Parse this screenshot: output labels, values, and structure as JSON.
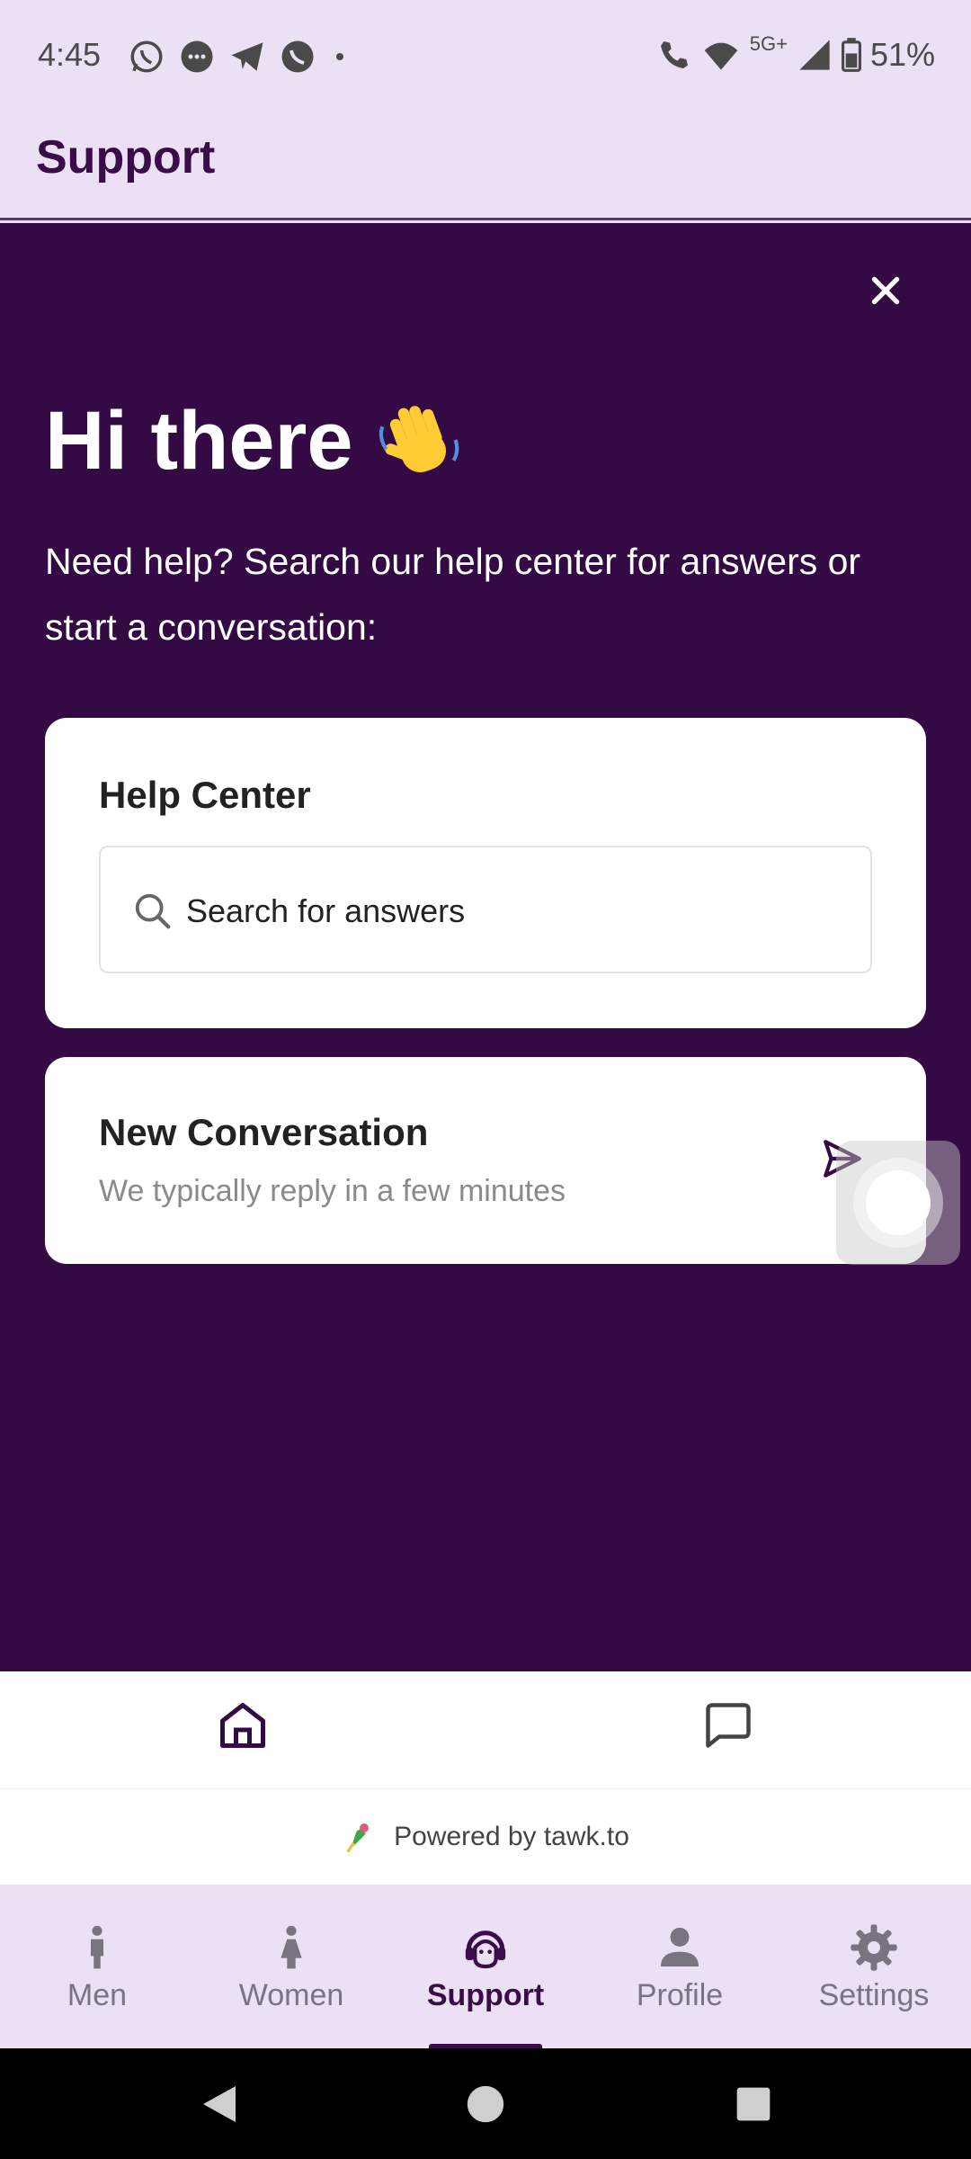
{
  "status_bar": {
    "time": "4:45",
    "network": "5G+",
    "battery": "51%",
    "left_icons": [
      "whatsapp-icon",
      "messages-icon",
      "telegram-icon",
      "viber-icon",
      "dot-icon"
    ],
    "right_icons": [
      "wifi-calling-icon",
      "wifi-icon",
      "signal-icon",
      "battery-icon"
    ]
  },
  "app_bar": {
    "title": "Support"
  },
  "widget": {
    "greeting": "Hi there",
    "greeting_emoji": "waving-hand",
    "intro": "Need help? Search our help center for answers or start a conversation:",
    "help_center": {
      "title": "Help Center",
      "search_placeholder": "Search for answers"
    },
    "new_conversation": {
      "title": "New Conversation",
      "subtitle": "We typically reply in a few minutes"
    },
    "nav_icons": [
      "home-icon",
      "chat-icon"
    ],
    "powered_by": "Powered by tawk.to",
    "colors": {
      "background": "#330a44",
      "card": "#ffffff"
    }
  },
  "bottom_nav": {
    "items": [
      {
        "label": "Men",
        "icon": "man-icon",
        "active": false
      },
      {
        "label": "Women",
        "icon": "woman-icon",
        "active": false
      },
      {
        "label": "Support",
        "icon": "support-agent-icon",
        "active": true
      },
      {
        "label": "Profile",
        "icon": "person-icon",
        "active": false
      },
      {
        "label": "Settings",
        "icon": "gear-icon",
        "active": false
      }
    ],
    "colors": {
      "active": "#3a0d48",
      "inactive": "#7a7480",
      "background": "#ece0f4"
    }
  }
}
